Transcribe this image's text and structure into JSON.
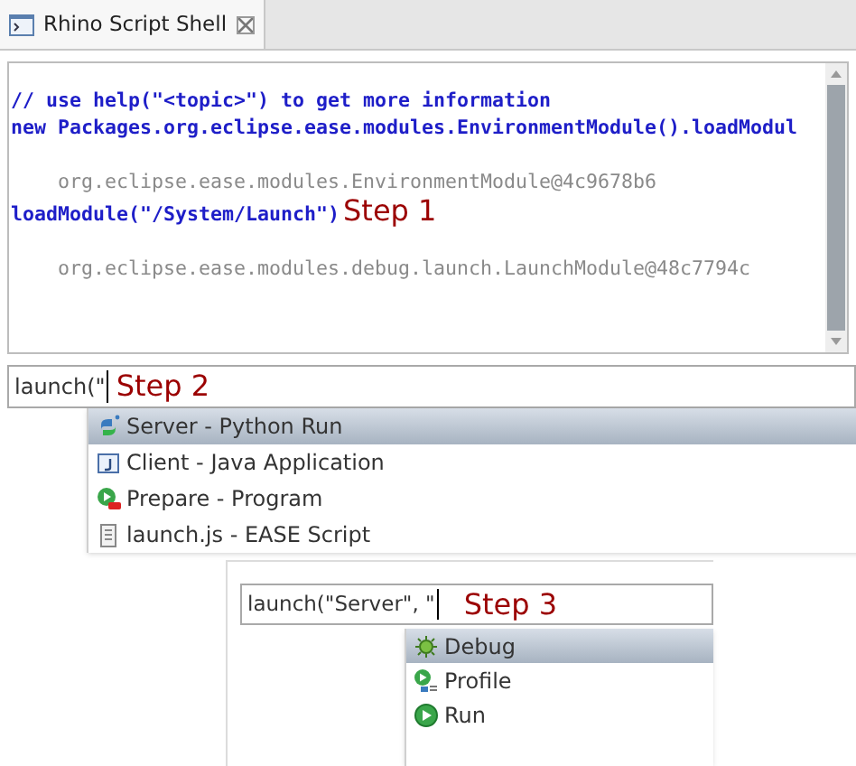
{
  "tab": {
    "title": "Rhino Script Shell",
    "selected": true
  },
  "console_lines": [
    {
      "kind": "input",
      "text": "// use help(\"<topic>\") to get more information"
    },
    {
      "kind": "input",
      "text": "new Packages.org.eclipse.ease.modules.EnvironmentModule().loadModul"
    },
    {
      "kind": "blank"
    },
    {
      "kind": "output",
      "text": "    org.eclipse.ease.modules.EnvironmentModule@4c9678b6"
    },
    {
      "kind": "input",
      "text": "loadModule(\"/System/Launch\")",
      "annotation": "Step 1"
    },
    {
      "kind": "blank"
    },
    {
      "kind": "output",
      "text": "    org.eclipse.ease.modules.debug.launch.LaunchModule@48c7794c"
    }
  ],
  "prompt": {
    "value": "launch(\"",
    "annotation": "Step 2"
  },
  "completions": [
    {
      "kind": "python",
      "label": "Server - Python Run",
      "selected": true
    },
    {
      "kind": "java",
      "label": "Client - Java Application",
      "selected": false
    },
    {
      "kind": "program",
      "label": "Prepare - Program",
      "selected": false
    },
    {
      "kind": "script",
      "label": "launch.js - EASE Script",
      "selected": false
    }
  ],
  "second_prompt": {
    "value": "launch(\"Server\", \"",
    "annotation": "Step 3"
  },
  "second_completions": [
    {
      "kind": "debug",
      "label": "Debug",
      "selected": true
    },
    {
      "kind": "profile",
      "label": "Profile",
      "selected": false
    },
    {
      "kind": "run",
      "label": "Run",
      "selected": false
    }
  ]
}
